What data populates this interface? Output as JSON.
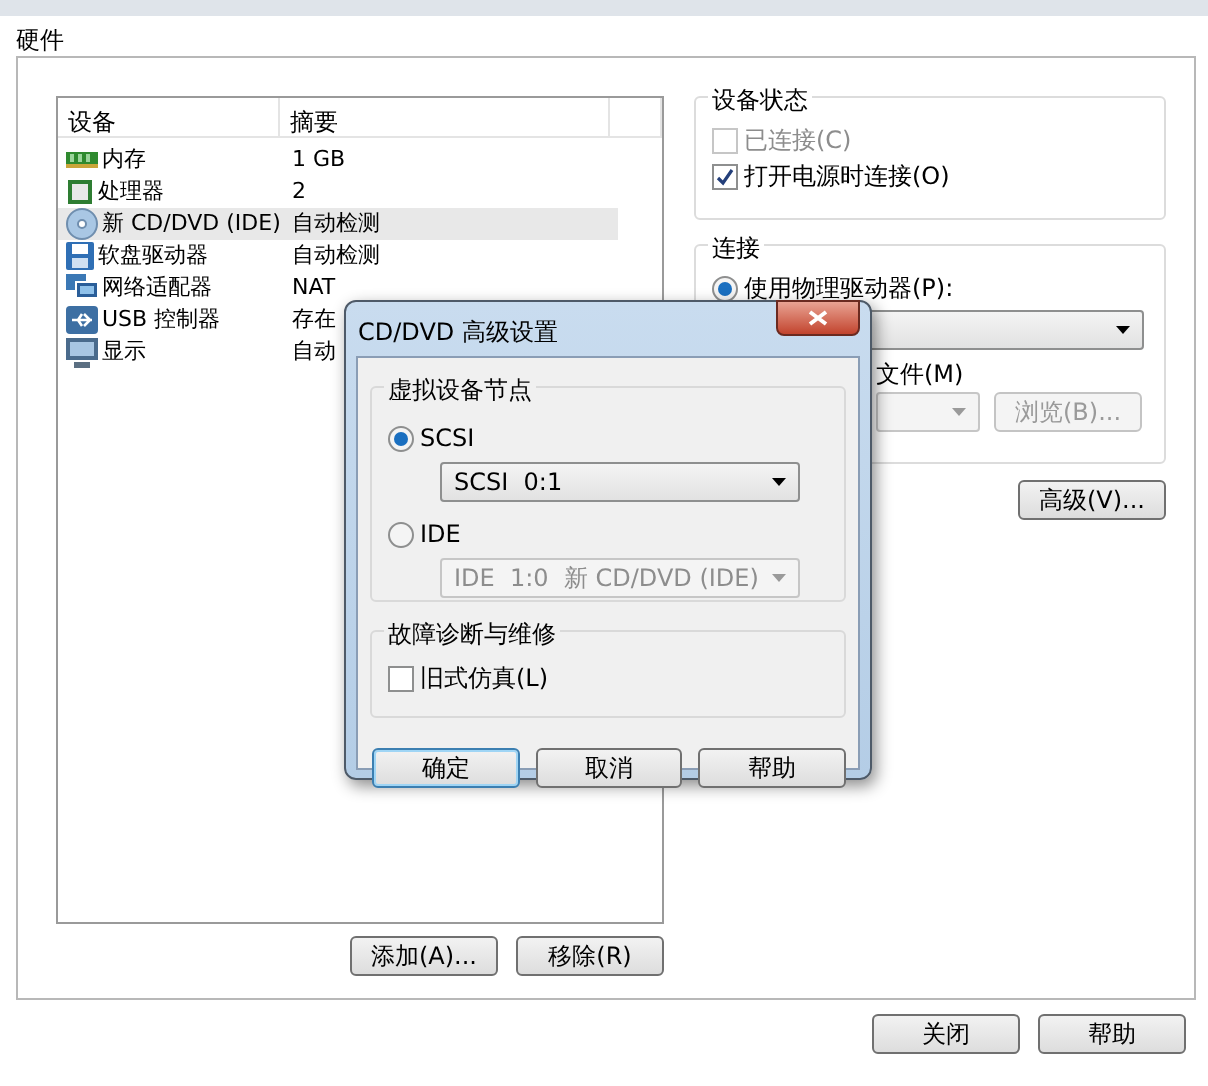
{
  "window": {
    "title": "硬件"
  },
  "device_table": {
    "columns": [
      "设备",
      "摘要"
    ],
    "rows": [
      {
        "kind": "memory",
        "device": "内存",
        "summary": "1 GB",
        "selected": false
      },
      {
        "kind": "processor",
        "device": "处理器",
        "summary": "2",
        "selected": false
      },
      {
        "kind": "disc",
        "device": "新 CD/DVD (IDE)",
        "summary": "自动检测",
        "selected": true
      },
      {
        "kind": "floppy",
        "device": "软盘驱动器",
        "summary": "自动检测",
        "selected": false
      },
      {
        "kind": "network",
        "device": "网络适配器",
        "summary": "NAT",
        "selected": false
      },
      {
        "kind": "usb",
        "device": "USB 控制器",
        "summary": "存在",
        "selected": false
      },
      {
        "kind": "display",
        "device": "显示",
        "summary": "自动",
        "selected": false
      }
    ]
  },
  "list_buttons": [
    "添加(A)...",
    "移除(R)"
  ],
  "device_status": {
    "title": "设备状态",
    "checkboxes": [
      {
        "label": "已连接(C)",
        "checked": false,
        "disabled": true
      },
      {
        "label": "打开电源时连接(O)",
        "checked": true,
        "disabled": false
      }
    ]
  },
  "connection": {
    "title": "连接",
    "physical_drive": {
      "label": "使用物理驱动器(P):",
      "selected": true
    },
    "iso_label": "文件(M)",
    "browse_button": {
      "label": "浏览(B)...",
      "disabled": true
    }
  },
  "advanced_button": "高级(V)...",
  "footer_buttons": [
    "关闭",
    "帮助"
  ],
  "dialog": {
    "title": "CD/DVD 高级设置",
    "node_group": {
      "title": "虚拟设备节点",
      "options": [
        {
          "label": "SCSI",
          "selected": true,
          "value": "SCSI  0:1"
        },
        {
          "label": "IDE",
          "selected": false,
          "value": "IDE  1:0  新 CD/DVD (IDE)"
        }
      ]
    },
    "troubleshoot": {
      "title": "故障诊断与维修",
      "checkbox": {
        "label": "旧式仿真(L)",
        "checked": false
      }
    },
    "buttons": [
      {
        "label": "确定",
        "focused": true
      },
      {
        "label": "取消",
        "focused": false
      },
      {
        "label": "帮助",
        "focused": false
      }
    ]
  }
}
